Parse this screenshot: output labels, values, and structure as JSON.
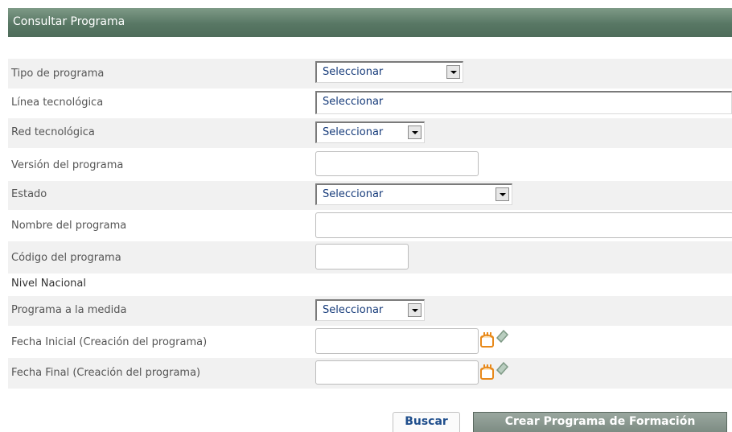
{
  "header": {
    "title": "Consultar Programa"
  },
  "form": {
    "tipo_programa": {
      "label": "Tipo de programa",
      "value": "Seleccionar"
    },
    "linea_tecnologica": {
      "label": "Línea tecnológica",
      "value": "Seleccionar"
    },
    "red_tecnologica": {
      "label": "Red tecnológica",
      "value": "Seleccionar"
    },
    "version_programa": {
      "label": "Versión del programa",
      "value": ""
    },
    "estado": {
      "label": "Estado",
      "value": "Seleccionar"
    },
    "nombre_programa": {
      "label": "Nombre del programa",
      "value": ""
    },
    "codigo_programa": {
      "label": "Código del programa",
      "value": ""
    },
    "nivel_nacional": {
      "label": "Nivel Nacional"
    },
    "programa_medida": {
      "label": "Programa a la medida",
      "value": "Seleccionar"
    },
    "fecha_inicial": {
      "label": "Fecha Inicial (Creación del programa)",
      "value": ""
    },
    "fecha_final": {
      "label": "Fecha Final (Creación del programa)",
      "value": ""
    }
  },
  "buttons": {
    "buscar": "Buscar",
    "crear": "Crear Programa de Formación"
  },
  "colors": {
    "header_bg": "#587764",
    "row_shade": "#f1f1f1",
    "select_text": "#163b7a",
    "calendar_icon": "#e8891a",
    "clear_icon": "#7f9a86"
  },
  "icons": {
    "calendar": "calendar-icon",
    "clear": "eraser-icon",
    "dropdown": "chevron-down-icon"
  }
}
